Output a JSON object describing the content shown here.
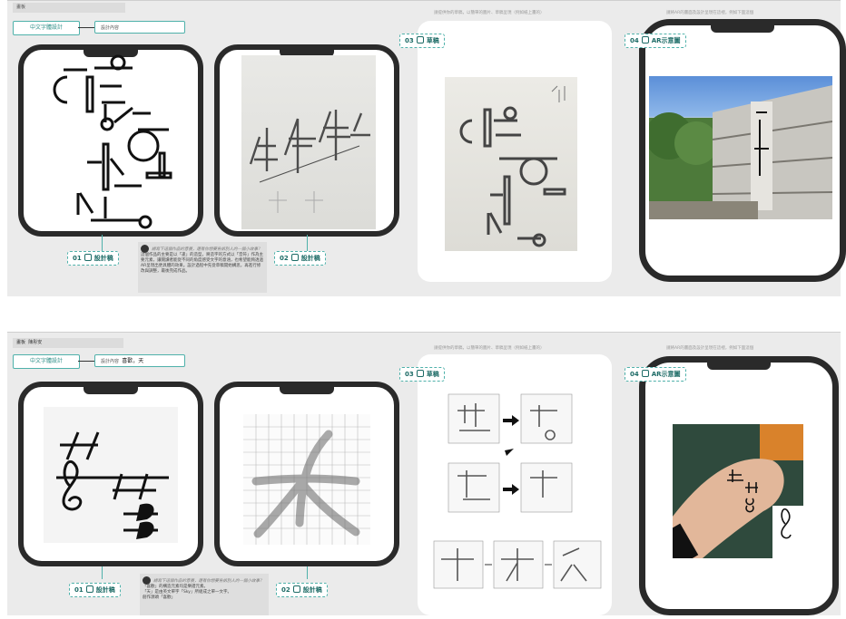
{
  "panel1": {
    "topbar": "畫板",
    "title": "中文字體設計",
    "subtitle": "設計內容",
    "caption_draft": "請提供你的草稿，以簡單的圖片、草稿呈現（例如紙上畫的）",
    "caption_ar": "請將AR的畫面及設計呈現在這裡，例如下面這個",
    "labels": {
      "design1": "01",
      "design1_text": "設計稿",
      "design2": "02",
      "design2_text": "設計稿",
      "draft": "03",
      "draft_text": "草稿",
      "ar": "04",
      "ar_text": "AR示意圖"
    },
    "note_question": "請寫下這個作品的意義，還有你想要告訴別人的一個小故事？",
    "note_body": "這個作品的主要是以「逢」的造型，將造字的方式以「音符」作為主要元素，讓閱讀者能從不同的角度感受文字的意涵，也希望能夠透過AR呈現出更具體的效果。設計過程中先從草稿開始構思，再進行修改與調整，最後完成作品。"
  },
  "panel2": {
    "topbar": "畫板",
    "name": "陳彤安",
    "title": "中文字體設計",
    "subtitle_small": "設計內容",
    "subtitle_main": "喜歡，天",
    "caption_draft": "請提供你的草稿，以簡單的圖片、草稿呈現（例如紙上畫的）",
    "caption_ar": "請將AR的畫面及設計呈現在這裡，例如下面這個",
    "labels": {
      "design1": "01",
      "design1_text": "設計稿",
      "design2": "02",
      "design2_text": "設計稿",
      "draft": "03",
      "draft_text": "草稿",
      "ar": "04",
      "ar_text": "AR示意圖"
    },
    "note_question": "請寫下這個作品的意義，還有你想要告訴別人的一個小故事？",
    "note_line1": "「喜歡」的構造元素均是樂譜元素。",
    "note_line2": "「天」是由英文單字「Sky」所組成之單一文字。",
    "note_line3": "創作源頭「喜歡」"
  }
}
